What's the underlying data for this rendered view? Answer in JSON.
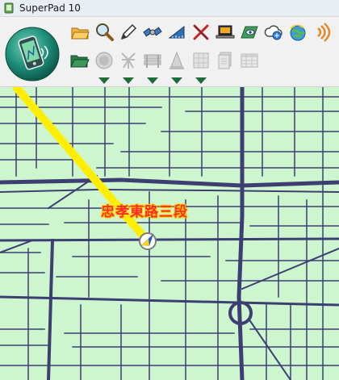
{
  "window": {
    "title": "SuperPad 10",
    "icon": "gps-app-icon"
  },
  "toolbar": {
    "row1": [
      {
        "name": "open-folder-icon"
      },
      {
        "name": "search-icon"
      },
      {
        "name": "pen-icon"
      },
      {
        "name": "satellite-icon"
      },
      {
        "name": "ruler-icon"
      },
      {
        "name": "close-tools-icon"
      },
      {
        "name": "laptop-icon"
      },
      {
        "name": "map-view-icon"
      },
      {
        "name": "cloud-icon"
      },
      {
        "name": "globe-icon"
      },
      {
        "name": "signal-icon"
      }
    ],
    "row2": [
      {
        "name": "folder-open-icon",
        "enabled": true
      },
      {
        "name": "record-icon",
        "enabled": false
      },
      {
        "name": "tower-icon",
        "enabled": false
      },
      {
        "name": "barrier-icon",
        "enabled": false
      },
      {
        "name": "cone-icon",
        "enabled": false
      },
      {
        "name": "grid-icon",
        "enabled": false
      },
      {
        "name": "document-icon",
        "enabled": false
      },
      {
        "name": "table-icon",
        "enabled": false
      }
    ]
  },
  "map": {
    "road_label": "忠孝東路三段",
    "background_color": "#cdf6cf",
    "road_color": "#3d3e72",
    "route_color": "#ffee00"
  }
}
